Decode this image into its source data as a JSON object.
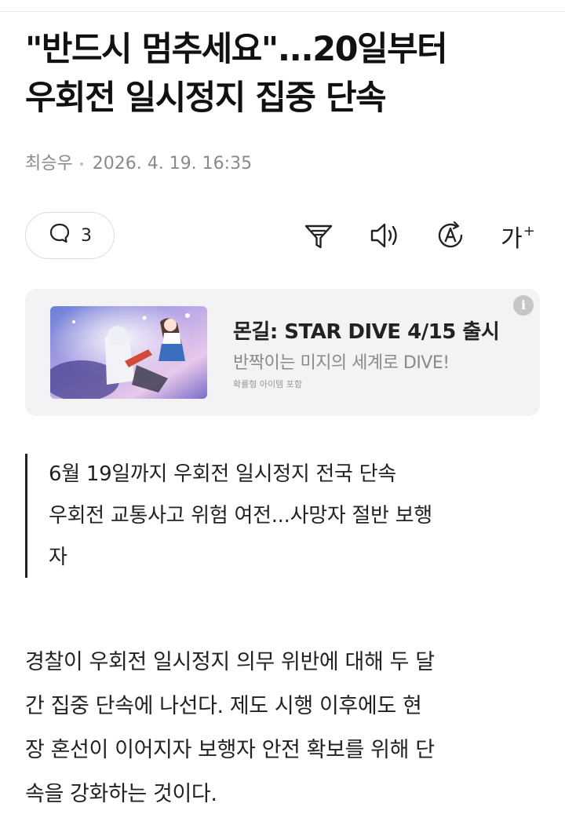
{
  "article": {
    "headline_lines": [
      "\"반드시 멈추세요\"...20일부터",
      "우회전 일시정지 집중 단속"
    ],
    "author": "최승우",
    "datetime": "2026. 4. 19. 16:35"
  },
  "toolbar": {
    "comment_count": "3",
    "icons": [
      "comment-icon",
      "summary-icon",
      "speaker-icon",
      "translate-icon",
      "font-size-icon"
    ],
    "font_size_label": "가",
    "font_size_plus": "+"
  },
  "ad": {
    "title": "몬길: STAR DIVE 4/15 출시",
    "subtitle": "반짝이는 미지의 세계로 DIVE!",
    "note": "확률형 아이템 포함",
    "info_glyph": "i"
  },
  "summary_lines": [
    "6월 19일까지 우회전 일시정지 전국 단속",
    "우회전 교통사고 위험 여전...사망자 절반 보행",
    "자"
  ],
  "body_lines": [
    "경찰이 우회전 일시정지 의무 위반에 대해 두 달",
    "간 집중 단속에 나선다. 제도 시행 이후에도 현",
    "장 혼선이 이어지자 보행자 안전 확보를 위해 단",
    "속을 강화하는 것이다."
  ]
}
